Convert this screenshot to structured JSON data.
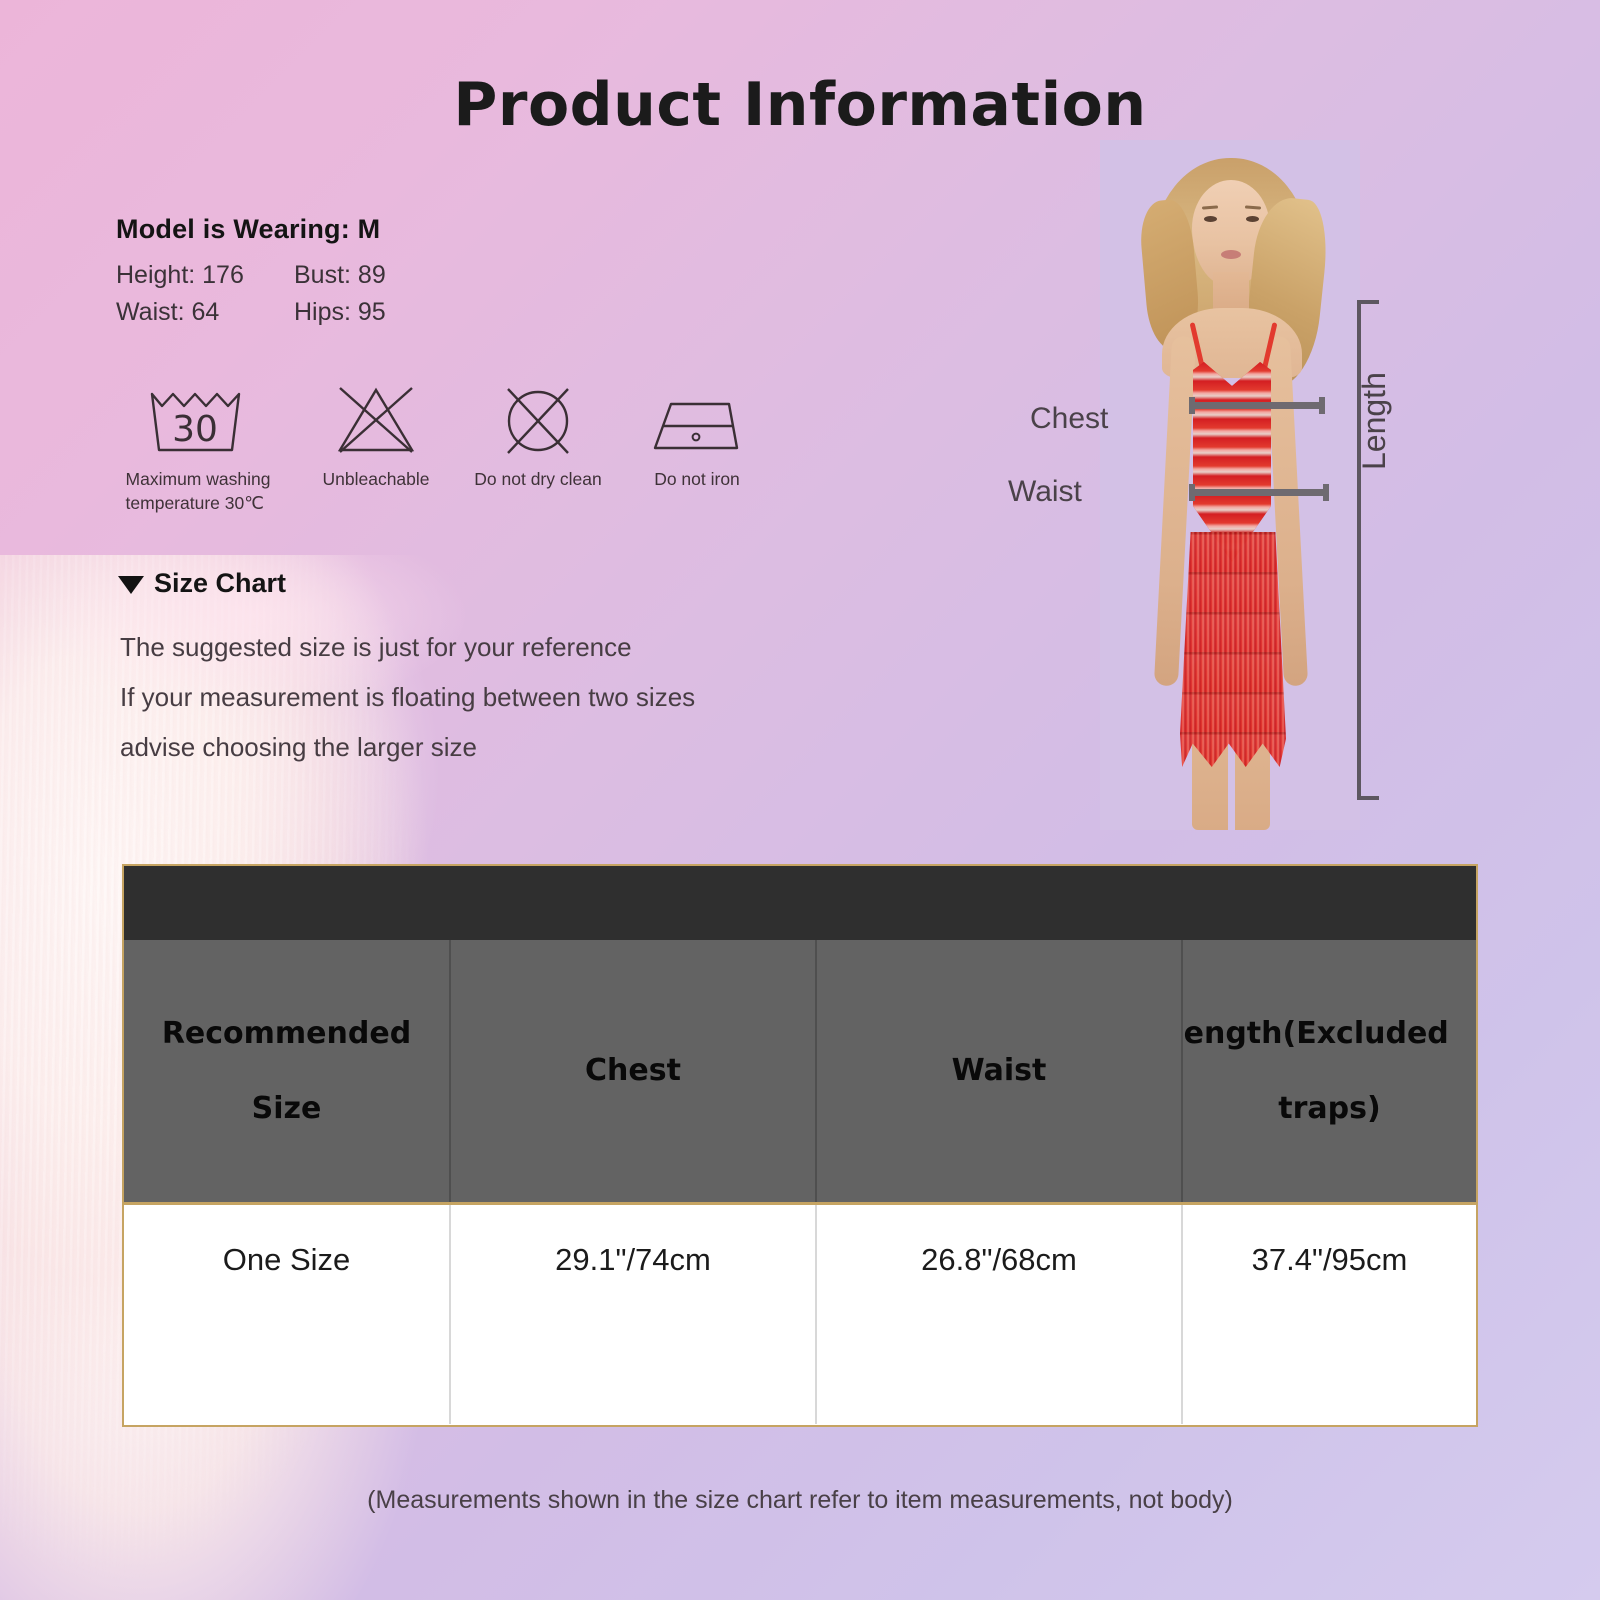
{
  "page": {
    "title": "Product  Information",
    "footnote": "(Measurements shown in the size chart refer to item measurements, not body)"
  },
  "model_info": {
    "title": "Model is Wearing: M",
    "measurements": [
      {
        "label": "Height: 176"
      },
      {
        "label": "Bust: 89"
      },
      {
        "label": "Waist: 64"
      },
      {
        "label": "Hips: 95"
      }
    ]
  },
  "care_symbols": [
    {
      "icon": "wash-30-icon",
      "label": "Maximum washing\ntemperature 30℃"
    },
    {
      "icon": "no-bleach-icon",
      "label": "Unbleachable"
    },
    {
      "icon": "no-dry-clean-icon",
      "label": "Do not dry clean"
    },
    {
      "icon": "no-iron-icon",
      "label": "Do not iron"
    }
  ],
  "size_chart": {
    "heading": "Size Chart",
    "notes": [
      "The suggested size is just for your reference",
      "If your measurement is floating between two sizes",
      "advise choosing the larger size"
    ]
  },
  "photo_labels": {
    "chest": "Chest",
    "waist": "Waist",
    "length": "Length"
  },
  "table": {
    "headers": [
      {
        "line1": "Recommended",
        "line2": "Size"
      },
      {
        "line1": "",
        "line2": "Chest"
      },
      {
        "line1": "",
        "line2": "Waist"
      },
      {
        "line1": "Length(Excluded",
        "line2": "traps)"
      }
    ],
    "rows": [
      {
        "size": "One Size",
        "chest": "29.1\"/74cm",
        "waist": "26.8\"/68cm",
        "length": "37.4\"/95cm"
      }
    ]
  },
  "colors": {
    "bg_pink": "#ecb5d9",
    "bg_lavender": "#d4c8ec",
    "table_border": "#c6a462",
    "table_band": "#2f2f2f",
    "table_header": "#636363",
    "dress_red": "#d41f22"
  }
}
